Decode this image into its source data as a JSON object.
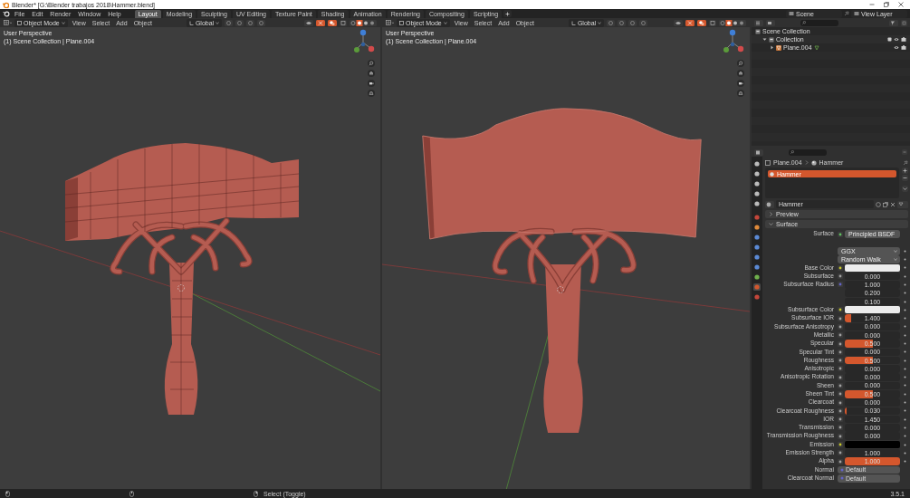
{
  "title_bar": {
    "title": "Blender* [G:\\Blender trabajos 2018\\Hammer.blend]"
  },
  "menu": [
    "File",
    "Edit",
    "Render",
    "Window",
    "Help"
  ],
  "workspaces": [
    {
      "label": "Layout",
      "selected": true
    },
    {
      "label": "Modeling",
      "selected": false
    },
    {
      "label": "Sculpting",
      "selected": false
    },
    {
      "label": "UV Editing",
      "selected": false
    },
    {
      "label": "Texture Paint",
      "selected": false
    },
    {
      "label": "Shading",
      "selected": false
    },
    {
      "label": "Animation",
      "selected": false
    },
    {
      "label": "Rendering",
      "selected": false
    },
    {
      "label": "Compositing",
      "selected": false
    },
    {
      "label": "Scripting",
      "selected": false
    }
  ],
  "scene": "Scene",
  "view_layer": "View Layer",
  "viewports": [
    {
      "kind": "wireframe",
      "mode": "Object Mode",
      "menus": [
        "View",
        "Select",
        "Add",
        "Object"
      ],
      "orientation": "Global",
      "perspective": "User Perspective",
      "context": "(1) Scene Collection | Plane.004"
    },
    {
      "kind": "solid",
      "mode": "Object Mode",
      "menus": [
        "View",
        "Select",
        "Add",
        "Object"
      ],
      "orientation": "Global",
      "perspective": "User Perspective",
      "context": "(1) Scene Collection | Plane.004"
    }
  ],
  "outliner": {
    "tree": [
      {
        "kind": "scene-collection",
        "label": "Scene Collection",
        "children": [
          {
            "kind": "collection",
            "label": "Collection",
            "expanded": true,
            "children": [
              {
                "kind": "mesh-object",
                "label": "Plane.004",
                "expanded": false
              }
            ]
          }
        ]
      }
    ]
  },
  "properties": {
    "breadcrumb": [
      "Plane.004",
      "Hammer"
    ],
    "slots": [
      {
        "label": "Hammer",
        "selected": true
      }
    ],
    "material": "Hammer",
    "panels": [
      {
        "label": "Preview",
        "expanded": false
      },
      {
        "label": "Surface",
        "expanded": true
      }
    ],
    "surface_label": "Surface",
    "shader": "Principled BSDF",
    "distribution": "GGX",
    "subsurface_method": "Random Walk",
    "inputs": [
      {
        "kind": "color",
        "label": "Base Color",
        "color": "#ececec"
      },
      {
        "kind": "slider",
        "label": "Subsurface",
        "value": "0.000",
        "level": 0
      },
      {
        "kind": "vector",
        "label": "Subsurface Radius",
        "values": [
          "1.000",
          "0.200",
          "0.100"
        ]
      },
      {
        "kind": "color",
        "label": "Subsurface Color",
        "color": "#ececec"
      },
      {
        "kind": "slider",
        "label": "Subsurface IOR",
        "value": "1.400",
        "level": 0.12
      },
      {
        "kind": "slider",
        "label": "Subsurface Anisotropy",
        "value": "0.000",
        "level": 0
      },
      {
        "kind": "slider",
        "label": "Metallic",
        "value": "0.000",
        "level": 0
      },
      {
        "kind": "slider",
        "label": "Specular",
        "value": "0.500",
        "level": 0.5
      },
      {
        "kind": "slider",
        "label": "Specular Tint",
        "value": "0.000",
        "level": 0
      },
      {
        "kind": "slider",
        "label": "Roughness",
        "value": "0.500",
        "level": 0.5
      },
      {
        "kind": "slider",
        "label": "Anisotropic",
        "value": "0.000",
        "level": 0
      },
      {
        "kind": "slider",
        "label": "Anisotropic Rotation",
        "value": "0.000",
        "level": 0
      },
      {
        "kind": "slider",
        "label": "Sheen",
        "value": "0.000",
        "level": 0
      },
      {
        "kind": "slider",
        "label": "Sheen Tint",
        "value": "0.500",
        "level": 0.5
      },
      {
        "kind": "slider",
        "label": "Clearcoat",
        "value": "0.000",
        "level": 0
      },
      {
        "kind": "slider",
        "label": "Clearcoat Roughness",
        "value": "0.030",
        "level": 0.03
      },
      {
        "kind": "number",
        "label": "IOR",
        "value": "1.450"
      },
      {
        "kind": "slider",
        "label": "Transmission",
        "value": "0.000",
        "level": 0
      },
      {
        "kind": "slider",
        "label": "Transmission Roughness",
        "value": "0.000",
        "level": 0
      },
      {
        "kind": "color",
        "label": "Emission",
        "color": "#000000"
      },
      {
        "kind": "number",
        "label": "Emission Strength",
        "value": "1.000"
      },
      {
        "kind": "slider",
        "label": "Alpha",
        "value": "1.000",
        "level": 1
      },
      {
        "kind": "link",
        "label": "Normal",
        "value": "Default"
      },
      {
        "kind": "link",
        "label": "Clearcoat Normal",
        "value": "Default"
      }
    ]
  },
  "status_bar": {
    "hint": "Select (Toggle)",
    "version": "3.5.1"
  }
}
